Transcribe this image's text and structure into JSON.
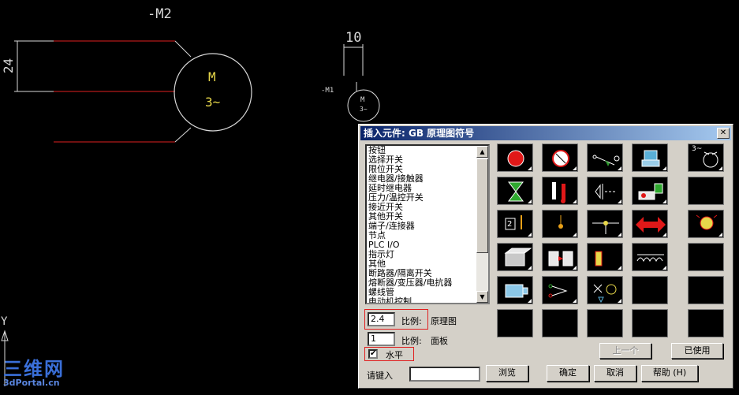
{
  "drawing": {
    "large_motor_tag": "-M2",
    "large_motor_letter": "M",
    "large_motor_phase": "3~",
    "vertical_dimension": "24",
    "small_dimension": "10",
    "small_motor_tag": "-M1",
    "small_motor_letter": "M",
    "small_motor_phase": "3~",
    "ucs_axis_label": "Y"
  },
  "watermark": {
    "big": "三维网",
    "small": "3dPortal.cn"
  },
  "dialog": {
    "title": "插入元件: GB 原理图符号",
    "close_glyph": "✕",
    "categories": [
      "按钮",
      "选择开关",
      "限位开关",
      "继电器/接触器",
      "延时继电器",
      "压力/温控开关",
      "接近开关",
      "其他开关",
      "端子/连接器",
      "节点",
      "PLC I/O",
      "指示灯",
      "其他",
      "断路器/隔离开关",
      "熔断器/变压器/电抗器",
      "螺线管",
      "电动机控制"
    ],
    "schematic_scale": {
      "value": "2.4",
      "label": "比例:",
      "suffix": "原理图"
    },
    "panel_scale": {
      "value": "1",
      "label": "比例:",
      "suffix": "面板"
    },
    "horizontal_checkbox": {
      "checked_glyph": "✔",
      "label": "水平"
    },
    "input_label": "请键入",
    "input_value": "",
    "buttons": {
      "browse": "浏览",
      "previous": "上一个",
      "used": "已使用",
      "ok": "确定",
      "cancel": "取消",
      "help": "帮助 (H)"
    },
    "tile_preview_label": "3~",
    "tile_counter_label": "2",
    "scroll_up_glyph": "▲",
    "scroll_down_glyph": "▼"
  }
}
